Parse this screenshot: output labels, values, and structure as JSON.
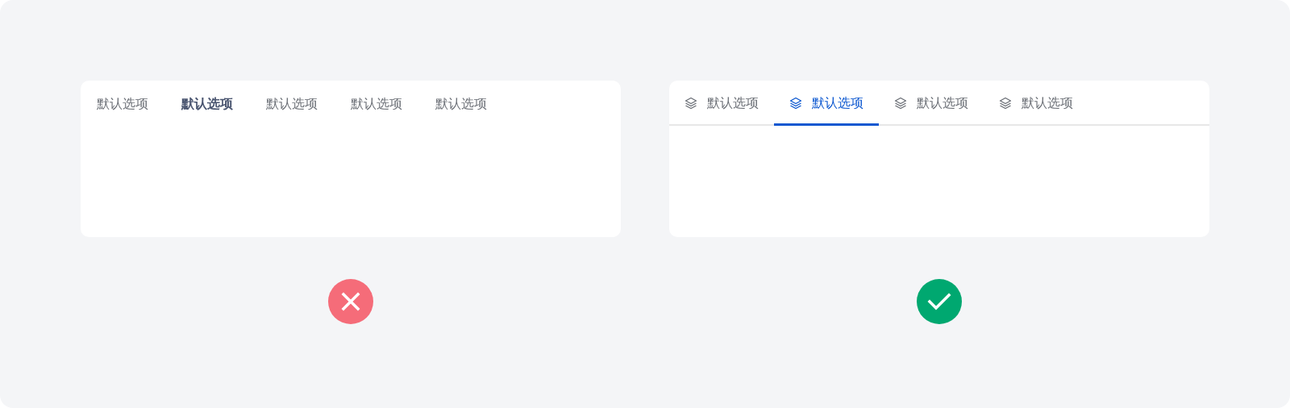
{
  "examples": [
    {
      "kind": "bad",
      "tabs": [
        {
          "label": "默认选项",
          "selected": false
        },
        {
          "label": "默认选项",
          "selected": true
        },
        {
          "label": "默认选项",
          "selected": false
        },
        {
          "label": "默认选项",
          "selected": false
        },
        {
          "label": "默认选项",
          "selected": false
        }
      ]
    },
    {
      "kind": "good",
      "tabs": [
        {
          "label": "默认选项",
          "selected": false
        },
        {
          "label": "默认选项",
          "selected": true
        },
        {
          "label": "默认选项",
          "selected": false
        },
        {
          "label": "默认选项",
          "selected": false
        }
      ]
    }
  ]
}
